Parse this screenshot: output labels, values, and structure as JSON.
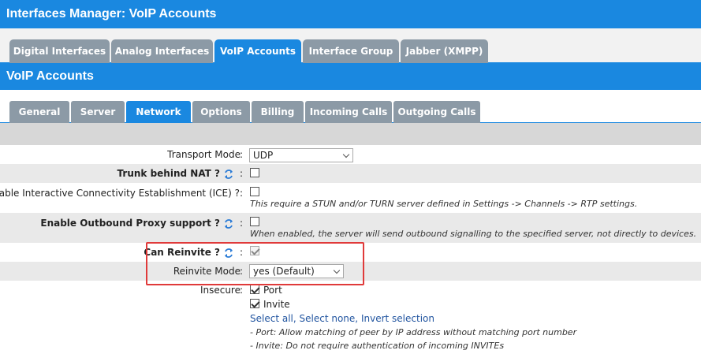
{
  "header": {
    "title": "Interfaces Manager:  VoIP Accounts"
  },
  "tabs": [
    {
      "label": "Digital Interfaces",
      "active": false
    },
    {
      "label": "Analog Interfaces",
      "active": false
    },
    {
      "label": "VoIP Accounts",
      "active": true
    },
    {
      "label": "Interface Group",
      "active": false
    },
    {
      "label": "Jabber (XMPP)",
      "active": false
    }
  ],
  "section": {
    "title": "VoIP Accounts"
  },
  "subtabs": [
    {
      "label": "General",
      "active": false
    },
    {
      "label": "Server",
      "active": false
    },
    {
      "label": "Network",
      "active": true
    },
    {
      "label": "Options",
      "active": false
    },
    {
      "label": "Billing",
      "active": false
    },
    {
      "label": "Incoming Calls",
      "active": false
    },
    {
      "label": "Outgoing Calls",
      "active": false
    }
  ],
  "form": {
    "colon": ":",
    "transport_mode": {
      "label": "Transport Mode",
      "value": "UDP"
    },
    "trunk_nat": {
      "label": "Trunk behind NAT ?",
      "checked": false
    },
    "ice": {
      "label": "Enable Interactive Connectivity Establishment (ICE) ?",
      "checked": false,
      "note": "This require a STUN and/or TURN server defined in Settings -> Channels -> RTP settings."
    },
    "outbound_proxy": {
      "label": "Enable Outbound Proxy support ?",
      "checked": false,
      "note": "When enabled, the server will send outbound signalling to the specified server, not directly to devices."
    },
    "can_reinvite": {
      "label": "Can Reinvite ?",
      "checked": true
    },
    "reinvite_mode": {
      "label": "Reinvite Mode",
      "value": "yes (Default)"
    },
    "insecure": {
      "label": "Insecure",
      "options": [
        {
          "label": "Port",
          "checked": true
        },
        {
          "label": "Invite",
          "checked": true
        }
      ],
      "links": {
        "select_all": "Select all",
        "select_none": "Select none",
        "invert": "Invert selection",
        "separator": ","
      },
      "notes": [
        "- Port: Allow matching of peer by IP address without matching port number",
        "- Invite: Do not require authentication of incoming INVITEs"
      ]
    }
  },
  "colors": {
    "accent": "#1a88e0",
    "tab_inactive": "#8c9aa6",
    "highlight": "#e03a3a",
    "row_shade": "#e9e9e9",
    "link": "#2255a0"
  },
  "icons": {
    "help": "refresh-help-icon"
  }
}
